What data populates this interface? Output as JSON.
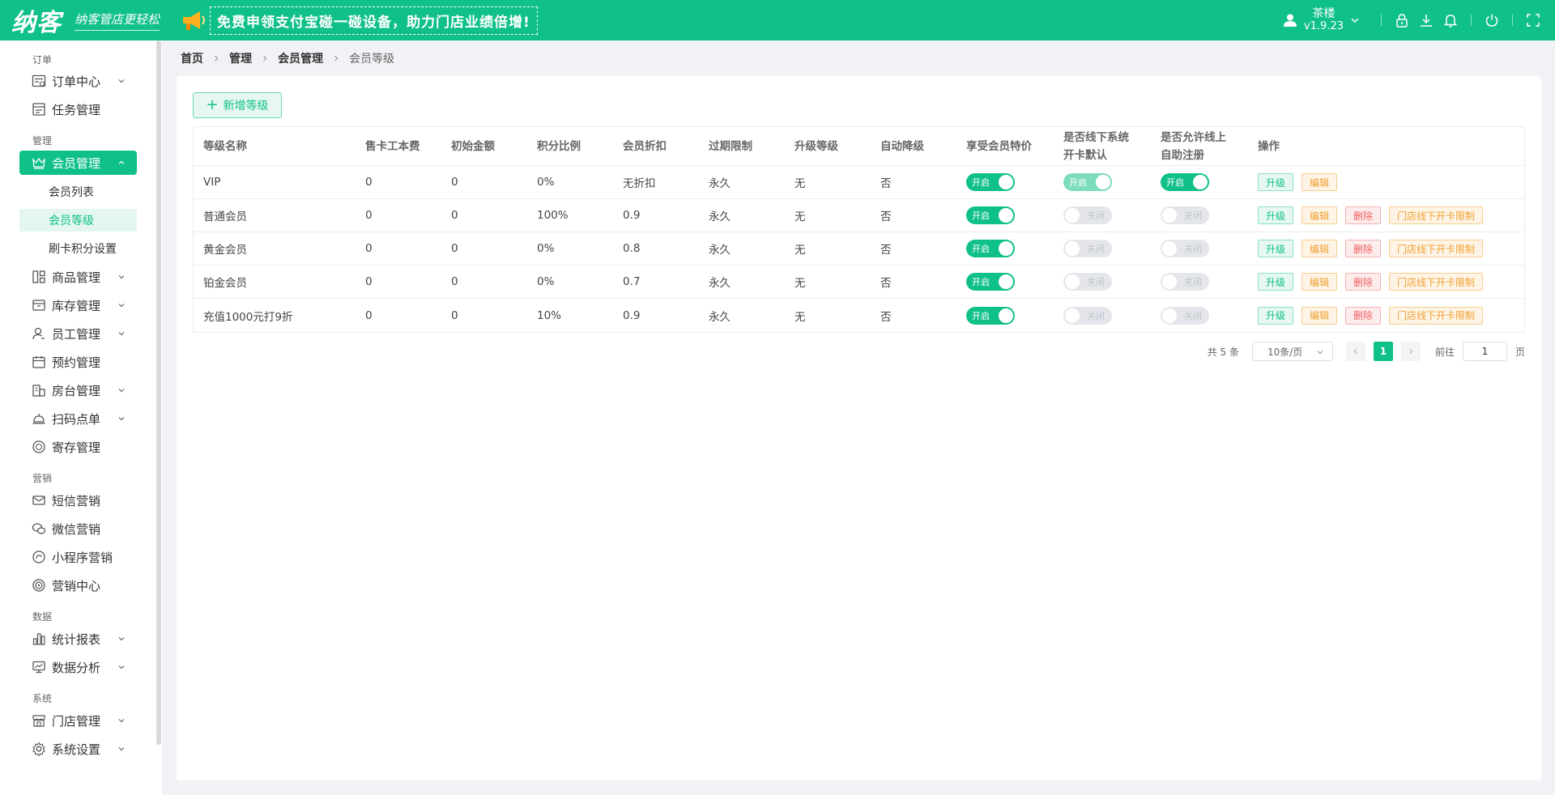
{
  "header": {
    "logo": "纳客",
    "slogan": "纳客管店更轻松",
    "promo": "免费申领支付宝碰一碰设备，助力门店业绩倍增!",
    "user_name": "茶楼",
    "version": "v1.9.23"
  },
  "sidebar": {
    "groups": {
      "order": "订单",
      "manage": "管理",
      "marketing": "营销",
      "data": "数据",
      "system": "系统"
    },
    "items": {
      "order_center": "订单中心",
      "task_mgmt": "任务管理",
      "member_mgmt": "会员管理",
      "member_list": "会员列表",
      "member_level": "会员等级",
      "card_points": "刷卡积分设置",
      "product_mgmt": "商品管理",
      "inventory_mgmt": "库存管理",
      "staff_mgmt": "员工管理",
      "booking_mgmt": "预约管理",
      "room_mgmt": "房台管理",
      "scan_order": "扫码点单",
      "storage_mgmt": "寄存管理",
      "sms_marketing": "短信营销",
      "wechat_marketing": "微信营销",
      "miniapp_marketing": "小程序营销",
      "marketing_center": "营销中心",
      "stats_report": "统计报表",
      "data_analysis": "数据分析",
      "store_mgmt": "门店管理",
      "system_settings": "系统设置"
    }
  },
  "breadcrumb": {
    "home": "首页",
    "manage": "管理",
    "member_mgmt": "会员管理",
    "current": "会员等级"
  },
  "toolbar": {
    "add_label": "新增等级"
  },
  "table": {
    "headers": {
      "name": "等级名称",
      "fee": "售卡工本费",
      "initial": "初始金额",
      "points": "积分比例",
      "discount": "会员折扣",
      "expire": "过期限制",
      "upgrade": "升级等级",
      "auto_down": "自动降级",
      "special": "享受会员特价",
      "offline_default_1": "是否线下系统",
      "offline_default_2": "开卡默认",
      "online_reg_1": "是否允许线上",
      "online_reg_2": "自助注册",
      "ops": "操作"
    },
    "switch_on": "开启",
    "switch_off": "关闭",
    "actions": {
      "upgrade": "升级",
      "edit": "编辑",
      "delete": "删除",
      "offline_limit": "门店线下开卡限制"
    },
    "rows": [
      {
        "name": "VIP",
        "fee": "0",
        "initial": "0",
        "points": "0%",
        "discount": "无折扣",
        "expire": "永久",
        "upgrade": "无",
        "auto_down": "否",
        "special": true,
        "offline_default": true,
        "online_reg": true
      },
      {
        "name": "普通会员",
        "fee": "0",
        "initial": "0",
        "points": "100%",
        "discount": "0.9",
        "expire": "永久",
        "upgrade": "无",
        "auto_down": "否",
        "special": true,
        "offline_default": false,
        "online_reg": false
      },
      {
        "name": "黄金会员",
        "fee": "0",
        "initial": "0",
        "points": "0%",
        "discount": "0.8",
        "expire": "永久",
        "upgrade": "无",
        "auto_down": "否",
        "special": true,
        "offline_default": false,
        "online_reg": false
      },
      {
        "name": "铂金会员",
        "fee": "0",
        "initial": "0",
        "points": "0%",
        "discount": "0.7",
        "expire": "永久",
        "upgrade": "无",
        "auto_down": "否",
        "special": true,
        "offline_default": false,
        "online_reg": false
      },
      {
        "name": "充值1000元打9折",
        "fee": "0",
        "initial": "0",
        "points": "10%",
        "discount": "0.9",
        "expire": "永久",
        "upgrade": "无",
        "auto_down": "否",
        "special": true,
        "offline_default": false,
        "online_reg": false
      }
    ]
  },
  "pagination": {
    "total": "共 5 条",
    "page_size": "10条/页",
    "current": "1",
    "goto": "前往",
    "goto_value": "1",
    "unit": "页"
  },
  "colors": {
    "brand": "#10c089",
    "warning": "#f0a030",
    "danger": "#f06060"
  }
}
